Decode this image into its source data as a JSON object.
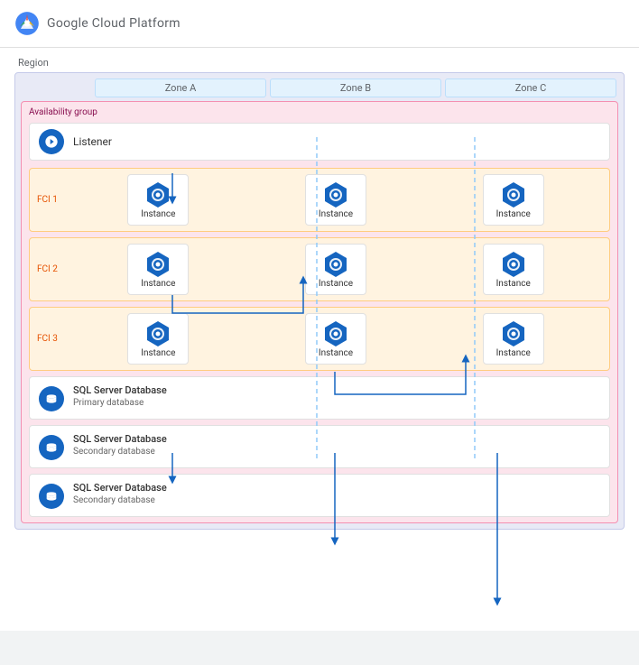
{
  "header": {
    "title": "Google Cloud Platform",
    "logo_alt": "Google Cloud Platform logo"
  },
  "diagram": {
    "region_label": "Region",
    "zones": [
      "Zone A",
      "Zone B",
      "Zone C"
    ],
    "availability_group_label": "Availability group",
    "listener_label": "Listener",
    "fci_rows": [
      {
        "label": "FCI 1",
        "instances": [
          {
            "label": "Instance",
            "zone": "A",
            "visible": true
          },
          {
            "label": "Instance",
            "zone": "B",
            "visible": true
          },
          {
            "label": "Instance",
            "zone": "C",
            "visible": true
          }
        ]
      },
      {
        "label": "FCI 2",
        "instances": [
          {
            "label": "Instance",
            "zone": "A",
            "visible": true
          },
          {
            "label": "Instance",
            "zone": "B",
            "visible": true
          },
          {
            "label": "Instance",
            "zone": "C",
            "visible": true
          }
        ]
      },
      {
        "label": "FCI 3",
        "instances": [
          {
            "label": "Instance",
            "zone": "A",
            "visible": true
          },
          {
            "label": "Instance",
            "zone": "B",
            "visible": true
          },
          {
            "label": "Instance",
            "zone": "C",
            "visible": true
          }
        ]
      }
    ],
    "databases": [
      {
        "title": "SQL Server Database",
        "subtitle": "Primary database",
        "type": "primary"
      },
      {
        "title": "SQL Server Database",
        "subtitle": "Secondary database",
        "type": "secondary"
      },
      {
        "title": "SQL Server Database",
        "subtitle": "Secondary database",
        "type": "secondary"
      }
    ]
  },
  "colors": {
    "accent_blue": "#1565c0",
    "light_blue": "#1976d2",
    "orange_bg": "#fff3e0",
    "orange_border": "#ffcc80",
    "pink_bg": "#fce4ec",
    "pink_border": "#f48fb1",
    "zone_bg": "#e3f2fd",
    "zone_border": "#bbdefb",
    "region_bg": "#e8eaf6",
    "region_border": "#c5cae9"
  }
}
